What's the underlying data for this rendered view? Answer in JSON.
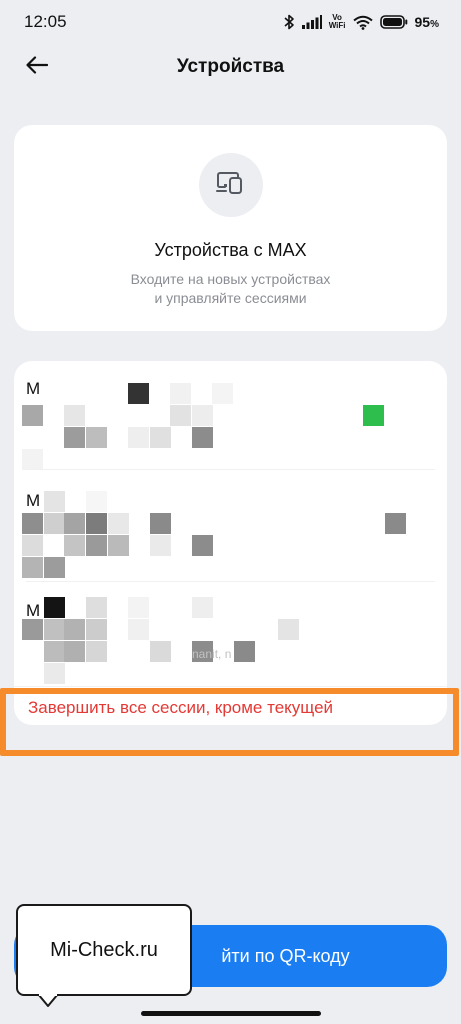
{
  "status_bar": {
    "time": "12:05",
    "network_label": "Vo\nWiFi",
    "battery_percent": "95",
    "battery_unit": "%",
    "icons": [
      "bluetooth-icon",
      "signal-icon",
      "wifi-icon",
      "battery-icon"
    ]
  },
  "header": {
    "title": "Устройства",
    "back_icon": "arrow-left-icon"
  },
  "info_card": {
    "icon": "devices-icon",
    "title": "Устройства с MAX",
    "subtitle_line1": "Входите на новых устройствах",
    "subtitle_line2": "и управляйте сессиями"
  },
  "sessions": {
    "items": [
      {
        "initial": "M",
        "status_color": "#2dbe4e",
        "note": ""
      },
      {
        "initial": "M",
        "note": ""
      },
      {
        "initial": "M",
        "note": "nanit, n"
      }
    ],
    "terminate_label": "Завершить все сессии, кроме текущей",
    "accent_color": "#e53935",
    "highlight_color": "#f58b2a"
  },
  "qr_button": {
    "label": "йти по QR-коду",
    "color": "#1a7ef2"
  },
  "watermark": {
    "text": "Mi-Check.ru"
  }
}
